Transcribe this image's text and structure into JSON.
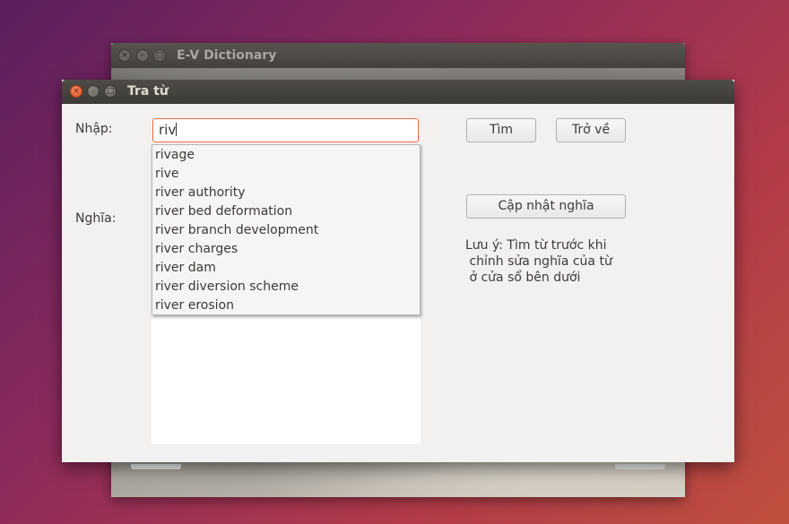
{
  "background_window": {
    "title": "E-V Dictionary"
  },
  "window": {
    "title": "Tra từ",
    "controls": {
      "close": "×",
      "minimize": "–",
      "maximize": "□"
    }
  },
  "form": {
    "input_label": "Nhập:",
    "input_value": "riv",
    "meaning_label": "Nghĩa:"
  },
  "buttons": {
    "search": "Tìm",
    "back": "Trở về",
    "update": "Cập nhật nghĩa"
  },
  "note": "Lưu ý: Tìm từ trước khi\n chỉnh sửa nghĩa của từ\n ở cửa sổ bên dưới",
  "suggestions": [
    "rivage",
    "rive",
    "river authority",
    "river bed deformation",
    "river branch development",
    "river charges",
    "river dam",
    "river diversion scheme",
    "river erosion"
  ],
  "colors": {
    "accent": "#e86b3f",
    "close": "#e0532a",
    "window_bg": "#f2f1f0"
  }
}
